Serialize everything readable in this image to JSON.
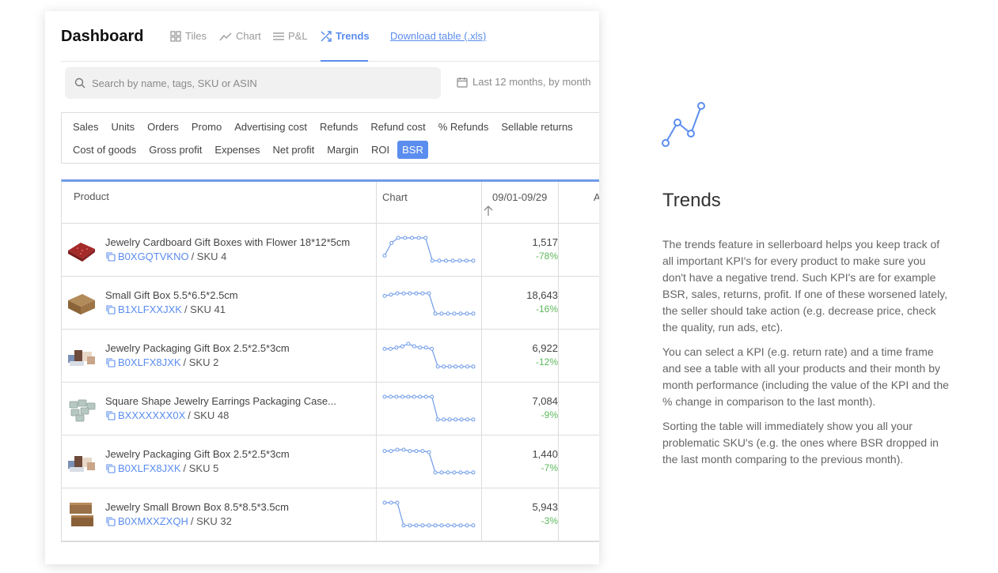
{
  "header": {
    "title": "Dashboard",
    "tabs": [
      {
        "label": "Tiles",
        "icon": "grid-icon"
      },
      {
        "label": "Chart",
        "icon": "line-chart-icon"
      },
      {
        "label": "P&L",
        "icon": "list-icon"
      },
      {
        "label": "Trends",
        "icon": "trends-icon",
        "active": true
      }
    ],
    "download_link": "Download table (.xls)"
  },
  "search": {
    "placeholder": "Search by name, tags, SKU or ASIN"
  },
  "date_range": "Last 12 months, by month",
  "kpis": {
    "row1": [
      "Sales",
      "Units",
      "Orders",
      "Promo",
      "Advertising cost",
      "Refunds",
      "Refund cost",
      "% Refunds",
      "Sellable returns"
    ],
    "row2": [
      "Cost of goods",
      "Gross profit",
      "Expenses",
      "Net profit",
      "Margin",
      "ROI",
      "BSR"
    ],
    "selected": "BSR"
  },
  "table": {
    "headers": {
      "product": "Product",
      "chart": "Chart",
      "period": "09/01-09/29",
      "next": "A"
    },
    "sort_icon": "arrow-up-icon",
    "rows": [
      {
        "name": "Jewelry Cardboard Gift Boxes with Flower 18*12*5cm",
        "asin": "B0XGQTVKNO",
        "sku": "/ SKU 4",
        "value": "1,517",
        "change": "-78%",
        "thumb": "red-gift-box",
        "trend": [
          3,
          8,
          10,
          10,
          10,
          10,
          10,
          1,
          1,
          1,
          1,
          1,
          1,
          1
        ]
      },
      {
        "name": "Small Gift Box 5.5*6.5*2.5cm",
        "asin": "B1XLFXXJXK",
        "sku": "/ SKU 41",
        "value": "18,643",
        "change": "-16%",
        "thumb": "brown-gift-box",
        "trend": [
          8,
          8.5,
          9,
          9,
          9,
          9,
          9,
          9,
          1,
          1,
          1,
          1,
          1,
          1,
          1
        ]
      },
      {
        "name": "Jewelry Packaging Gift Box 2.5*2.5*3cm",
        "asin": "B0XLFX8JXK",
        "sku": "/ SKU 2",
        "value": "6,922",
        "change": "-12%",
        "thumb": "jewelry-boxes",
        "trend": [
          8,
          8,
          8.5,
          9,
          10,
          9,
          8.5,
          8.5,
          8,
          1,
          1,
          1,
          1,
          1,
          1,
          1
        ]
      },
      {
        "name": "Square Shape Jewelry Earrings Packaging Case...",
        "asin": "BXXXXXXX0X",
        "sku": "/ SKU 48",
        "value": "7,084",
        "change": "-9%",
        "thumb": "silver-cases",
        "trend": [
          10,
          10,
          10,
          10,
          10,
          10,
          10,
          10,
          10,
          1,
          1,
          1,
          1,
          1,
          1,
          1
        ]
      },
      {
        "name": "Jewelry Packaging Gift Box 2.5*2.5*3cm",
        "asin": "B0XLFX8JXK",
        "sku": "/ SKU 5",
        "value": "1,440",
        "change": "-7%",
        "thumb": "jewelry-boxes",
        "trend": [
          9.5,
          9.5,
          10,
          10,
          9.5,
          9.5,
          9.5,
          9,
          1,
          1,
          1,
          1,
          1,
          1,
          1
        ]
      },
      {
        "name": "Jewelry Small Brown Box 8.5*8.5*3.5cm",
        "asin": "B0XMXXZXQH",
        "sku": "/ SKU 32",
        "value": "5,943",
        "change": "-3%",
        "thumb": "brown-boxes-stack",
        "trend": [
          10,
          10,
          10,
          1,
          1,
          1,
          1,
          1,
          1,
          1,
          1,
          1,
          1,
          1,
          1
        ]
      }
    ]
  },
  "info": {
    "title": "Trends",
    "paragraphs": [
      "The trends feature in sellerboard helps you keep track of all important KPI's for every product to make sure you don't have a negative trend. Such KPI's are for example BSR, sales, returns, profit. If one of these worsened lately, the seller should take action (e.g. decrease price, check the quality, run ads, etc).",
      "You can select a KPI (e.g. return rate) and a time frame and see a table with all your products and their month by month performance (including the value of the KPI and the % change in comparison to the last month).",
      "Sorting the table will immediately show you all your problematic SKU's (e.g. the ones where BSR dropped in the last month comparing to the previous month)."
    ]
  },
  "colors": {
    "accent": "#5b8def",
    "positive": "#5cb85c",
    "line": "#6f9be8"
  }
}
